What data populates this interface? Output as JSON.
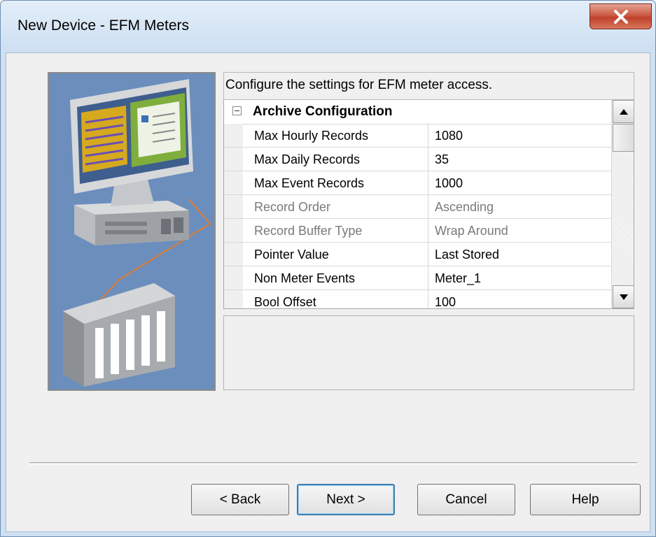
{
  "window": {
    "title": "New Device - EFM Meters"
  },
  "description": "Configure the settings for EFM meter access.",
  "property_grid": {
    "category": "Archive Configuration",
    "rows": [
      {
        "name": "Max Hourly Records",
        "value": "1080",
        "enabled": true
      },
      {
        "name": "Max Daily Records",
        "value": "35",
        "enabled": true
      },
      {
        "name": "Max Event Records",
        "value": "1000",
        "enabled": true
      },
      {
        "name": "Record Order",
        "value": "Ascending",
        "enabled": false
      },
      {
        "name": "Record Buffer Type",
        "value": "Wrap Around",
        "enabled": false
      },
      {
        "name": "Pointer Value",
        "value": "Last Stored",
        "enabled": true
      },
      {
        "name": "Non Meter Events",
        "value": "Meter_1",
        "enabled": true
      },
      {
        "name": "Bool Offset",
        "value": "100",
        "enabled": true
      }
    ]
  },
  "buttons": {
    "back": "< Back",
    "next": "Next >",
    "cancel": "Cancel",
    "help": "Help"
  },
  "icons": {
    "close": "close-icon",
    "collapse": "minus-box-icon",
    "scroll_up": "arrow-up-icon",
    "scroll_down": "arrow-down-icon"
  },
  "colors": {
    "title_bar": "#cfe0f3",
    "close_button": "#c9452f",
    "art_background": "#6b8ebd",
    "disabled_text": "#7a7a7a"
  }
}
